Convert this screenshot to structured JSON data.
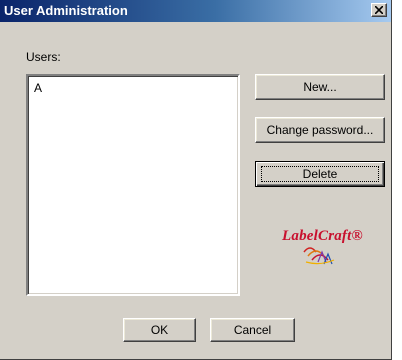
{
  "window": {
    "title": "User Administration"
  },
  "users_label": "Users:",
  "users_list": [
    "A"
  ],
  "buttons": {
    "new": "New...",
    "change_password": "Change password...",
    "delete": "Delete",
    "ok": "OK",
    "cancel": "Cancel"
  },
  "logo": {
    "text": "LabelCraft®"
  },
  "colors": {
    "titlebar_start": "#0a246a",
    "titlebar_end": "#a6caf0",
    "face": "#d4d0c8",
    "logo_red": "#c8102e"
  }
}
